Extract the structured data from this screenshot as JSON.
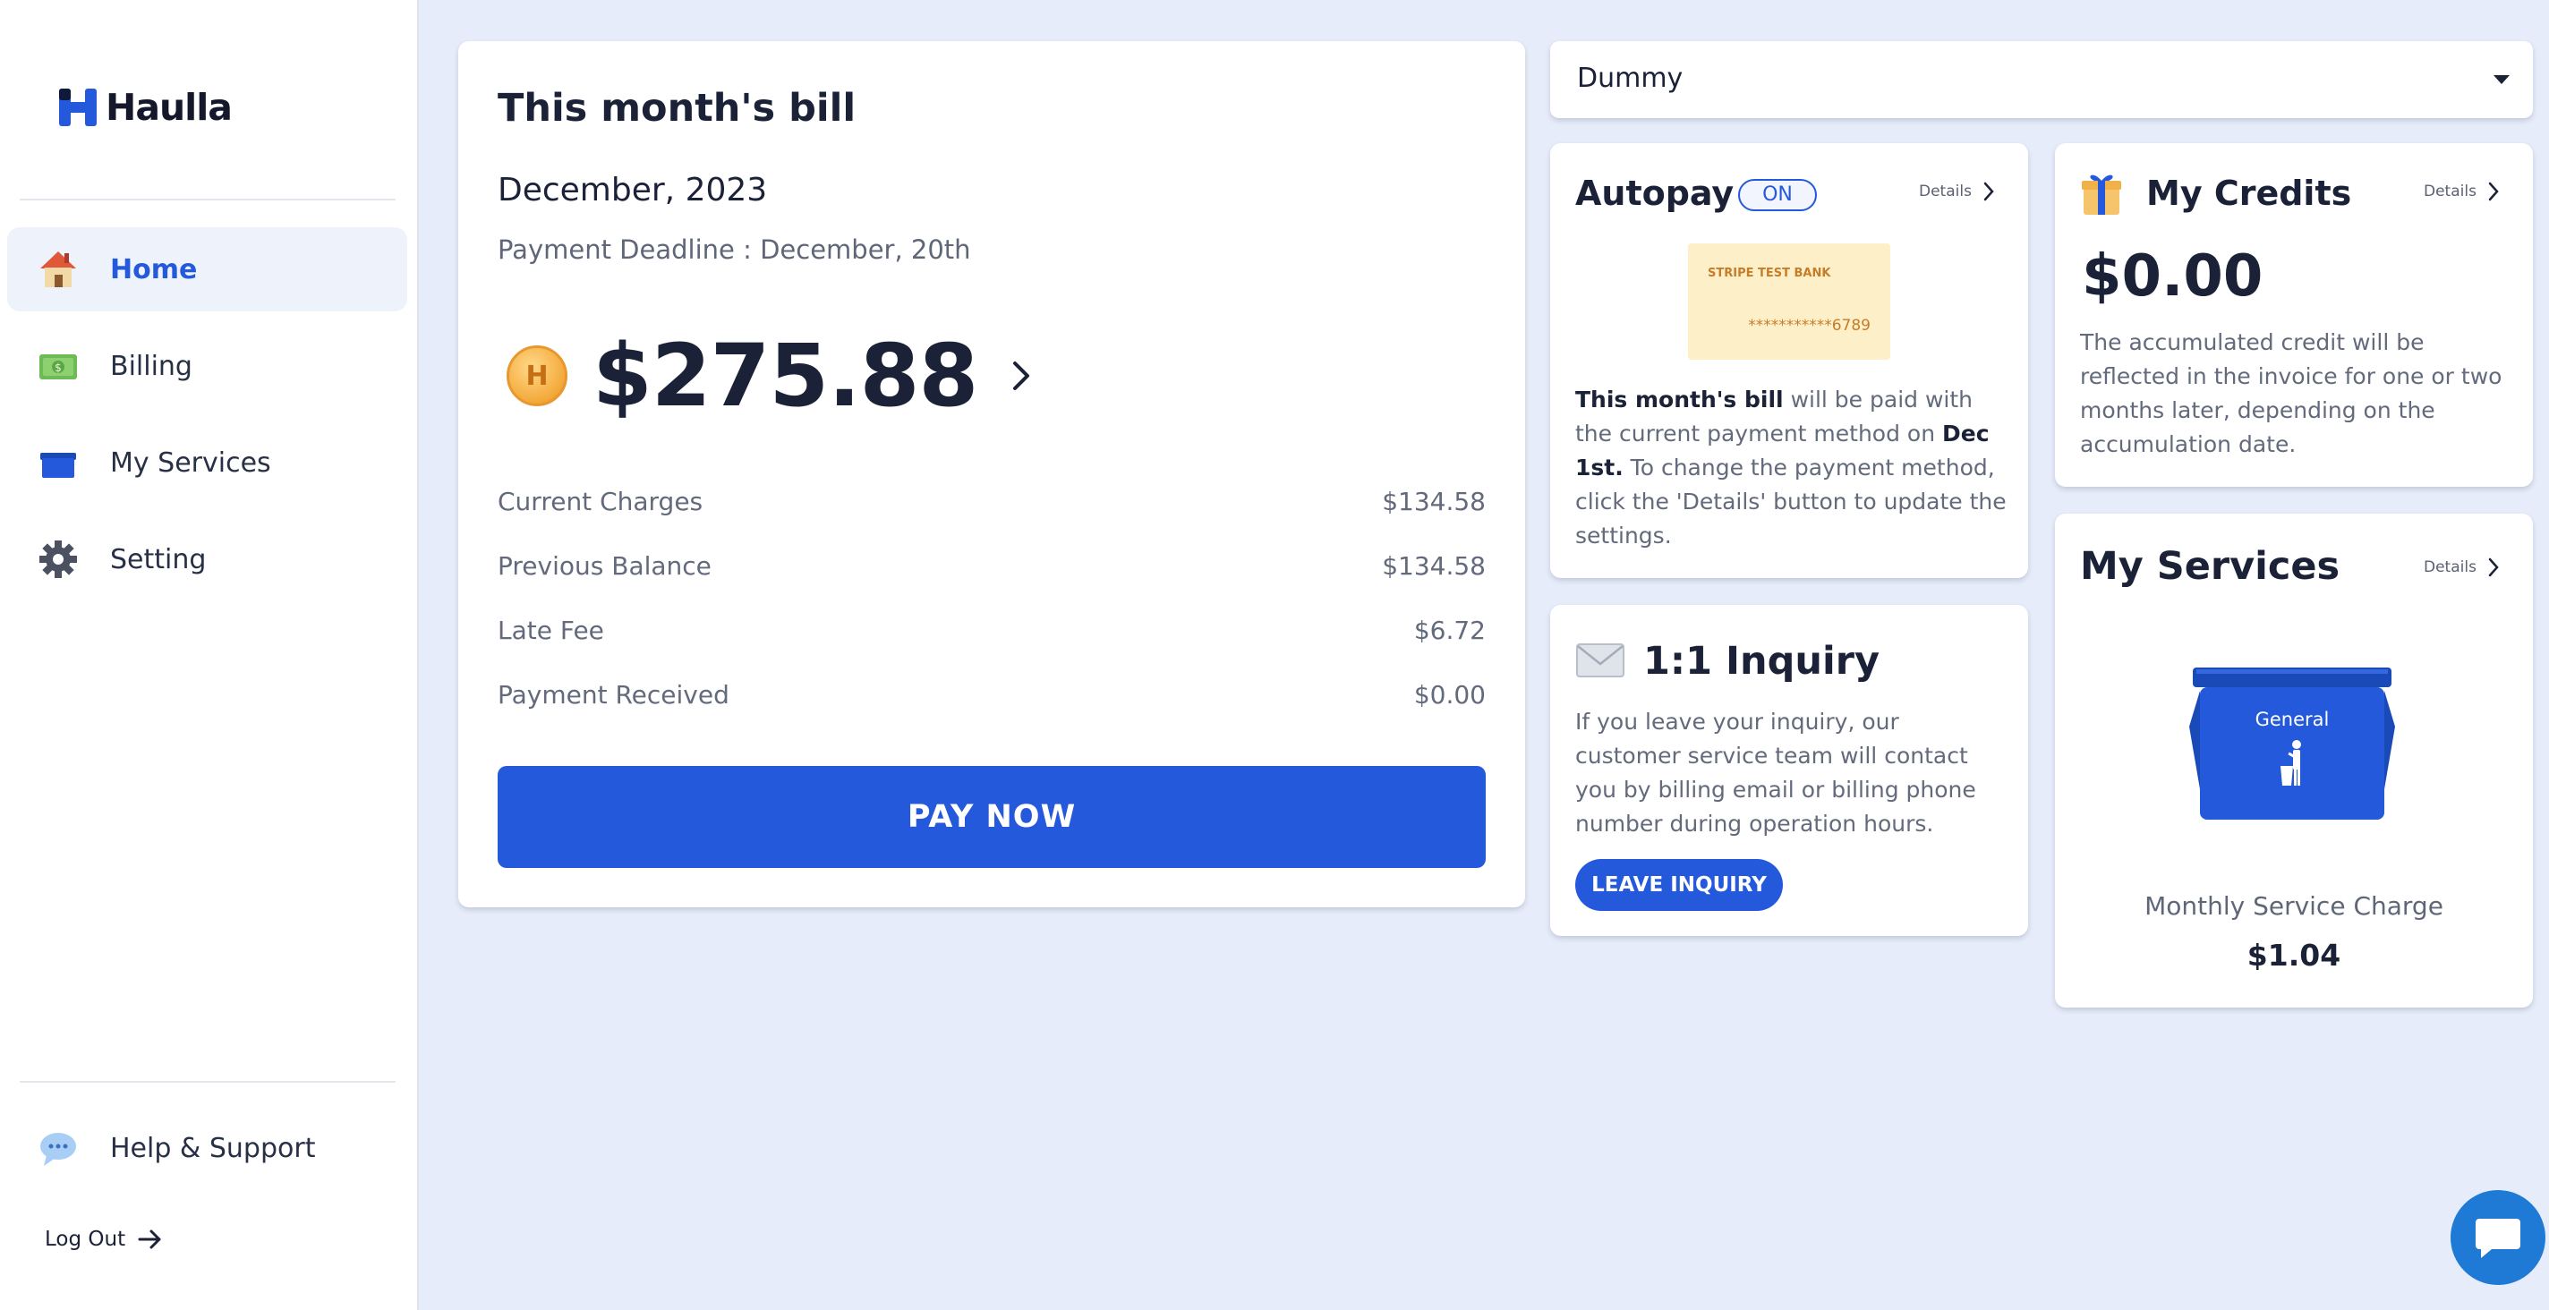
{
  "sidebar": {
    "logo_text": "Haulla",
    "nav": [
      {
        "label": "Home",
        "icon": "house-icon"
      },
      {
        "label": "Billing",
        "icon": "cash-icon"
      },
      {
        "label": "My Services",
        "icon": "dumpster-icon"
      },
      {
        "label": "Setting",
        "icon": "gear-icon"
      }
    ],
    "help_label": "Help & Support",
    "logout_label": "Log Out"
  },
  "bill": {
    "title": "This month's bill",
    "month": "December, 2023",
    "deadline": "Payment Deadline : December, 20th",
    "coin_letter": "H",
    "amount": "$275.88",
    "lines": [
      {
        "label": "Current Charges",
        "value": "$134.58"
      },
      {
        "label": "Previous Balance",
        "value": "$134.58"
      },
      {
        "label": "Late Fee",
        "value": "$6.72"
      },
      {
        "label": "Payment Received",
        "value": "$0.00"
      }
    ],
    "pay_label": "PAY NOW"
  },
  "account_select": {
    "value": "Dummy"
  },
  "autopay": {
    "title": "Autopay",
    "status": "ON",
    "details_label": "Details",
    "bank_name": "STRIPE TEST BANK",
    "card_number": "***********6789",
    "text_strong1": "This month's bill",
    "text_part1": " will be paid with the current payment method on ",
    "text_strong2": "Dec 1st.",
    "text_part2": " To change the payment method, click the 'Details' button to update the settings."
  },
  "credits": {
    "title": "My Credits",
    "details_label": "Details",
    "amount": "$0.00",
    "description": "The accumulated credit will be reflected in the invoice for one or two months later, depending on the accumulation date."
  },
  "inquiry": {
    "title": "1:1 Inquiry",
    "description": "If you leave your inquiry, our customer service team will contact you by billing email or billing phone number during operation hours.",
    "button_label": "LEAVE INQUIRY"
  },
  "services": {
    "title": "My Services",
    "details_label": "Details",
    "bin_label": "General",
    "charge_label": "Monthly Service Charge",
    "charge_value": "$1.04"
  },
  "colors": {
    "primary": "#2459dc",
    "background": "#e6ecf9",
    "text": "#1b2238"
  }
}
